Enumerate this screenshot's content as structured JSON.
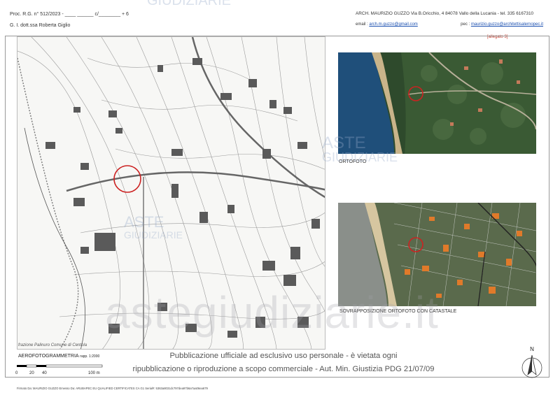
{
  "header": {
    "proc": "Proc. R.G. n° 512/2023 - ____ ______ c/________ + 6",
    "judge": "G. I. dott.ssa Roberta Giglio",
    "architect": "ARCH.  MAURIZIO GUZZO Via B.Oricchio, 4    84078 Vallo della Lucania - tel. 335 6167310",
    "email_label": "email : ",
    "email": "arch.m.guzzo@gmail.com",
    "pec_label": "pec : ",
    "pec": "maurizio.guzzo@architettisalernopec.it",
    "allegato": "[allegato 3]"
  },
  "captions": {
    "ortofoto": "ORTOFOTO",
    "sovrapposizione": "SOVRAPPOSIZIONE ORTOFOTO CON CATASTALE",
    "frazione": "frazione Palinuro Comune di Centola",
    "aero": "AEROFOTOGRAMMETRIA",
    "aero_scale": "rapp. 1:2000"
  },
  "scale_bar": {
    "labels": [
      "0",
      "20",
      "40",
      "100 m"
    ]
  },
  "notice": {
    "line1": "Pubblicazione ufficiale ad esclusivo uso personale - è vietata ogni",
    "line2": "ripubblicazione o riproduzione a scopo commerciale - Aut. Min. Giustizia PDG 21/07/09"
  },
  "signature": "Firmato Da: MAURIZIO GUZZO Emesso Da: ARUBAPEC EU QUALIFIED CERTIFICATES CA G1 Serial#: 5363a8031dc797dea97b6a7aa06ea679",
  "north_label": "N",
  "watermarks": {
    "top": "GIUDIZIARIE",
    "aste": "ASTE",
    "giudiziarie": "GIUDIZIARIE",
    "big": "astegiudiziarie.it"
  },
  "colors": {
    "marker_red": "#cc2222",
    "sea": "#1f4f7a",
    "vegetation": "#2f4a2a",
    "cadastral_orange": "#e07a2a"
  }
}
